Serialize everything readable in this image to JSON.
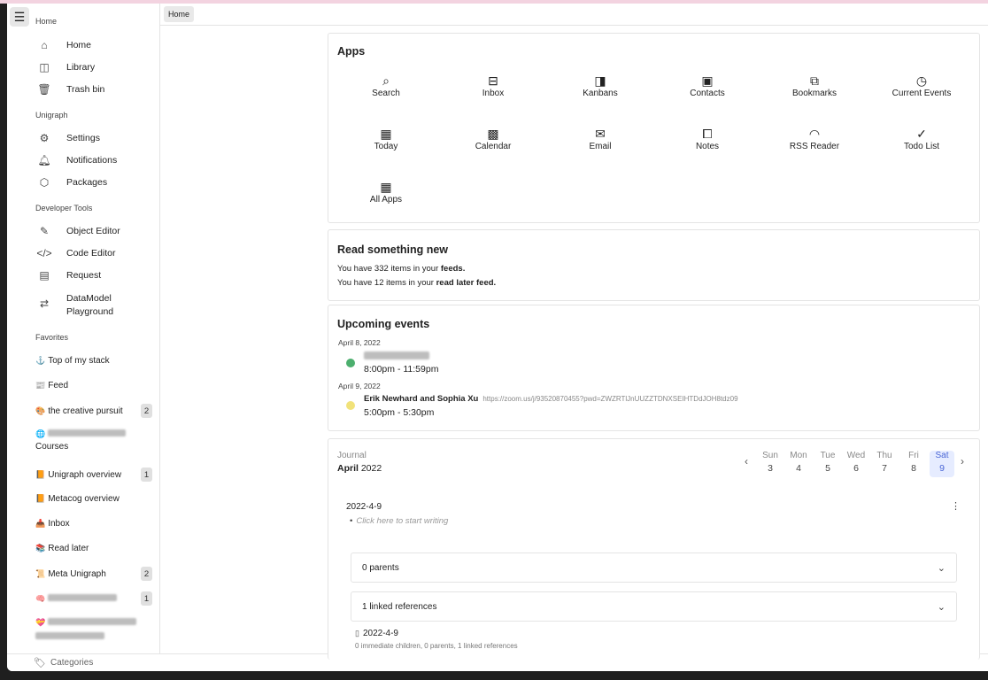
{
  "sidebar": {
    "sections": {
      "home": "Home",
      "unigraph": "Unigraph",
      "developer": "Developer Tools",
      "favorites": "Favorites"
    },
    "home_items": [
      {
        "label": "Home",
        "icon": "home-icon"
      },
      {
        "label": "Library",
        "icon": "library-icon"
      },
      {
        "label": "Trash bin",
        "icon": "trash-icon"
      }
    ],
    "unigraph_items": [
      {
        "label": "Settings",
        "icon": "gear-icon"
      },
      {
        "label": "Notifications",
        "icon": "bell-icon"
      },
      {
        "label": "Packages",
        "icon": "package-icon"
      }
    ],
    "dev_items": [
      {
        "label": "Object Editor",
        "icon": "object-editor-icon"
      },
      {
        "label": "Code Editor",
        "icon": "code-icon"
      },
      {
        "label": "Request",
        "icon": "request-icon"
      },
      {
        "label": "DataModel Playground",
        "icon": "datamodel-icon"
      }
    ],
    "favorites": [
      {
        "label": "Top of my stack",
        "emoji": "⚓",
        "count": ""
      },
      {
        "label": "Feed",
        "emoji": "📰",
        "count": ""
      },
      {
        "label": "the creative pursuit",
        "emoji": "🎨",
        "count": "2"
      },
      {
        "label": "Courses",
        "emoji": "🌐",
        "count": ""
      },
      {
        "label": "Unigraph overview",
        "emoji": "📙",
        "count": "1"
      },
      {
        "label": "Metacog overview",
        "emoji": "📙",
        "count": ""
      },
      {
        "label": "Inbox",
        "emoji": "📥",
        "count": ""
      },
      {
        "label": "Read later",
        "emoji": "📚",
        "count": ""
      },
      {
        "label": "Meta Unigraph",
        "emoji": "📜",
        "count": "2"
      },
      {
        "label": "",
        "emoji": "🧠",
        "count": "1"
      },
      {
        "label": "",
        "emoji": "💝",
        "count": ""
      }
    ],
    "categories_label": "Categories"
  },
  "tabbar": {
    "active_tab": "Home"
  },
  "apps": {
    "title": "Apps",
    "items": [
      {
        "label": "Search",
        "icon": "search-icon"
      },
      {
        "label": "Inbox",
        "icon": "inbox-icon"
      },
      {
        "label": "Kanbans",
        "icon": "kanban-icon"
      },
      {
        "label": "Contacts",
        "icon": "contacts-icon"
      },
      {
        "label": "Bookmarks",
        "icon": "bookmarks-icon"
      },
      {
        "label": "Current Events",
        "icon": "current-events-icon"
      },
      {
        "label": "Today",
        "icon": "today-icon"
      },
      {
        "label": "Calendar",
        "icon": "calendar-icon"
      },
      {
        "label": "Email",
        "icon": "email-icon"
      },
      {
        "label": "Notes",
        "icon": "notes-icon"
      },
      {
        "label": "RSS Reader",
        "icon": "rss-icon"
      },
      {
        "label": "Todo List",
        "icon": "todo-icon"
      },
      {
        "label": "All Apps",
        "icon": "grid-icon"
      }
    ]
  },
  "feeds": {
    "title": "Read something new",
    "line1_pre": "You have 332 items in your ",
    "line1_bold": "feeds.",
    "line2_pre": "You have 12 items in your ",
    "line2_bold": "read later feed."
  },
  "events": {
    "title": "Upcoming events",
    "items": [
      {
        "date": "April 8, 2022",
        "title": "",
        "link": "",
        "time": "8:00pm - 11:59pm",
        "color": "#4caf6e"
      },
      {
        "date": "April 9, 2022",
        "title": "Erik Newhard and Sophia Xu",
        "link": "https://zoom.us/j/93520870455?pwd=ZWZRTlJnUUZZTDNXSEIHTDdJOH8tdz09",
        "time": "5:00pm - 5:30pm",
        "color": "#f1e27a"
      }
    ]
  },
  "journal": {
    "label": "Journal",
    "month": "April",
    "year": "2022",
    "days": [
      {
        "name": "Sun",
        "num": "3"
      },
      {
        "name": "Mon",
        "num": "4"
      },
      {
        "name": "Tue",
        "num": "5"
      },
      {
        "name": "Wed",
        "num": "6"
      },
      {
        "name": "Thu",
        "num": "7"
      },
      {
        "name": "Fri",
        "num": "8"
      },
      {
        "name": "Sat",
        "num": "9"
      }
    ],
    "selected_day": "9",
    "entry_title": "2022-4-9",
    "placeholder": "Click here to start writing",
    "parents": "0 parents",
    "linked_refs": "1 linked references",
    "ref_title": "2022-4-9",
    "ref_meta": "0 immediate children, 0 parents, 1 linked references"
  },
  "colors": {
    "accent": "#4a66d6",
    "selected_bg": "#e6ecff"
  }
}
